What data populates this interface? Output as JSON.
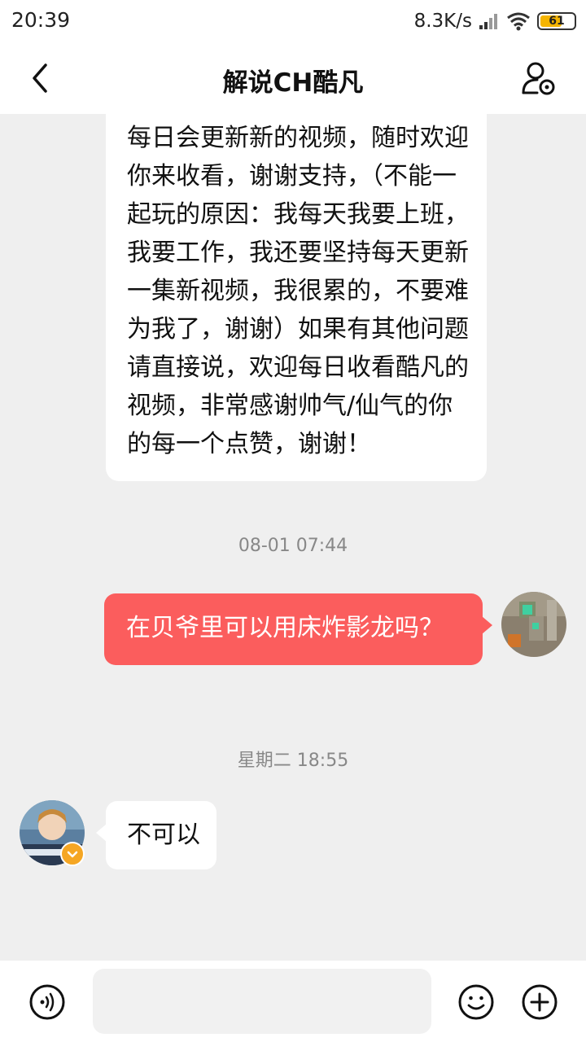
{
  "status_bar": {
    "time": "20:39",
    "net_speed": "8.3K/s",
    "battery": "61"
  },
  "header": {
    "title": "解说CH酷凡"
  },
  "messages": {
    "incoming_long": "每日会更新新的视频，随时欢迎你来收看，谢谢支持，（不能一起玩的原因：我每天我要上班，我要工作，我还要坚持每天更新一集新视频，我很累的，不要难为我了，谢谢）如果有其他问题请直接说，欢迎每日收看酷凡的视频，非常感谢帅气/仙气的你的每一个点赞，谢谢！",
    "timestamp_1": "08-01 07:44",
    "outgoing": "在贝爷里可以用床炸影龙吗？",
    "timestamp_2": "星期二 18:55",
    "incoming_short": "不可以"
  },
  "input": {
    "placeholder": ""
  },
  "colors": {
    "outgoing_bubble": "#fb5d5d",
    "background": "#efefef",
    "badge": "#f5a623"
  }
}
